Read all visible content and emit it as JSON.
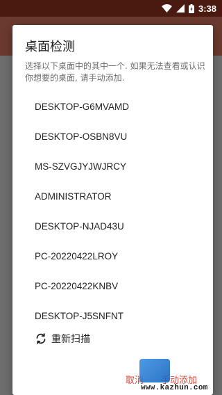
{
  "status_bar": {
    "time": "3:38"
  },
  "dialog": {
    "title": "桌面检测",
    "description": "选择以下桌面中的其中一个. 如果无法查看或认识你想要的桌面, 请手动添加.",
    "desktops": [
      "DESKTOP-G6MVAMD",
      "DESKTOP-OSBN8VU",
      "MS-SZVGJYJWJRCY",
      "ADMINISTRATOR",
      "DESKTOP-NJAD43U",
      "PC-20220422LROY",
      "PC-20220422KNBV",
      "DESKTOP-J5SNFNT"
    ],
    "rescan_label": "重新扫描",
    "cancel_label": "取消",
    "add_label": "手动添加"
  },
  "watermark": {
    "url": "www.kazhun.com"
  },
  "icons": {
    "wifi": "wifi-icon",
    "cellular": "cellular-icon",
    "battery": "battery-icon",
    "refresh": "refresh-icon"
  },
  "colors": {
    "status_bar": "#4a1a10",
    "app_bar": "#6b3a2e",
    "accent": "#d8473a"
  }
}
